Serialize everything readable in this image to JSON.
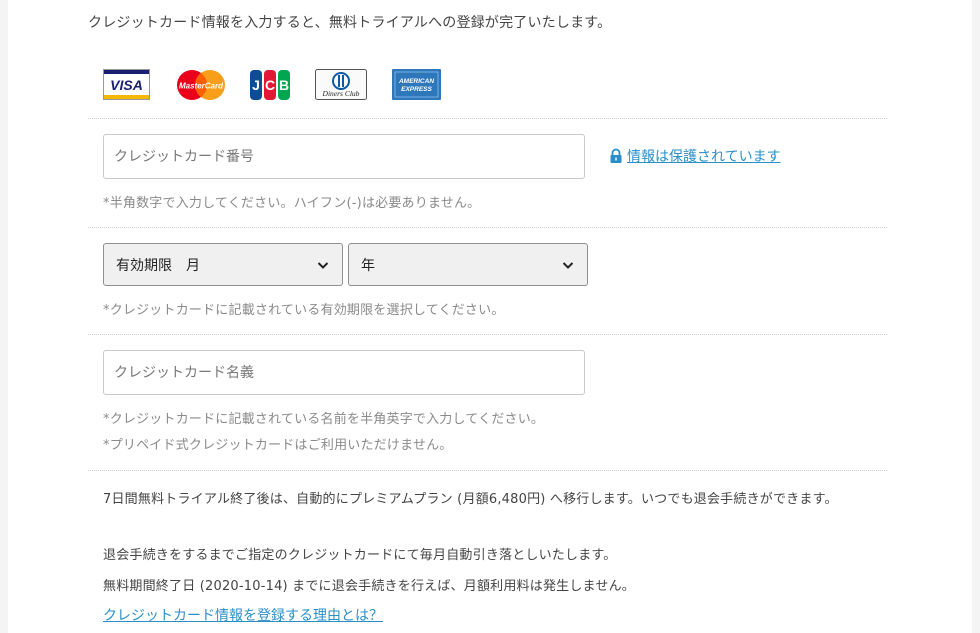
{
  "intro_text": "クレジットカード情報を入力すると、無料トライアルへの登録が完了いたします。",
  "card_brands": [
    {
      "name": "VISA",
      "label": "VISA"
    },
    {
      "name": "MasterCard",
      "label": "MasterCard"
    },
    {
      "name": "JCB",
      "label": "JCB"
    },
    {
      "name": "Diners Club",
      "label": "Diners Club"
    },
    {
      "name": "American Express",
      "label_line1": "AMERICAN",
      "label_line2": "EXPRESS"
    }
  ],
  "card_number": {
    "placeholder": "クレジットカード番号",
    "secure_link": "情報は保護されています",
    "hint": "*半角数字で入力してください。ハイフン(-)は必要ありません。"
  },
  "expiry": {
    "month_label": "有効期限　月",
    "year_label": "年",
    "hint": "*クレジットカードに記載されている有効期限を選択してください。"
  },
  "card_holder": {
    "placeholder": "クレジットカード名義",
    "hint1": "*クレジットカードに記載されている名前を半角英字で入力してください。",
    "hint2": "*プリペイド式クレジットカードはご利用いただけません。"
  },
  "notes": {
    "trial": "7日間無料トライアル終了後は、自動的にプレミアムプラン (月額6,480円) へ移行します。いつでも退会手続きができます。",
    "billing": "退会手続きをするまでご指定のクレジットカードにて毎月自動引き落としいたします。",
    "free_period": "無料期間終了日 (2020-10-14) までに退会手続きを行えば、月額利用料は発生しません。",
    "why_link": "クレジットカード情報を登録する理由とは？"
  },
  "colors": {
    "link": "#2a8fc8",
    "visa_blue": "#1a1f71",
    "visa_gold": "#f7b600",
    "mc_red": "#eb001b",
    "mc_orange": "#f79e1b",
    "amex_blue": "#2e77bb"
  }
}
